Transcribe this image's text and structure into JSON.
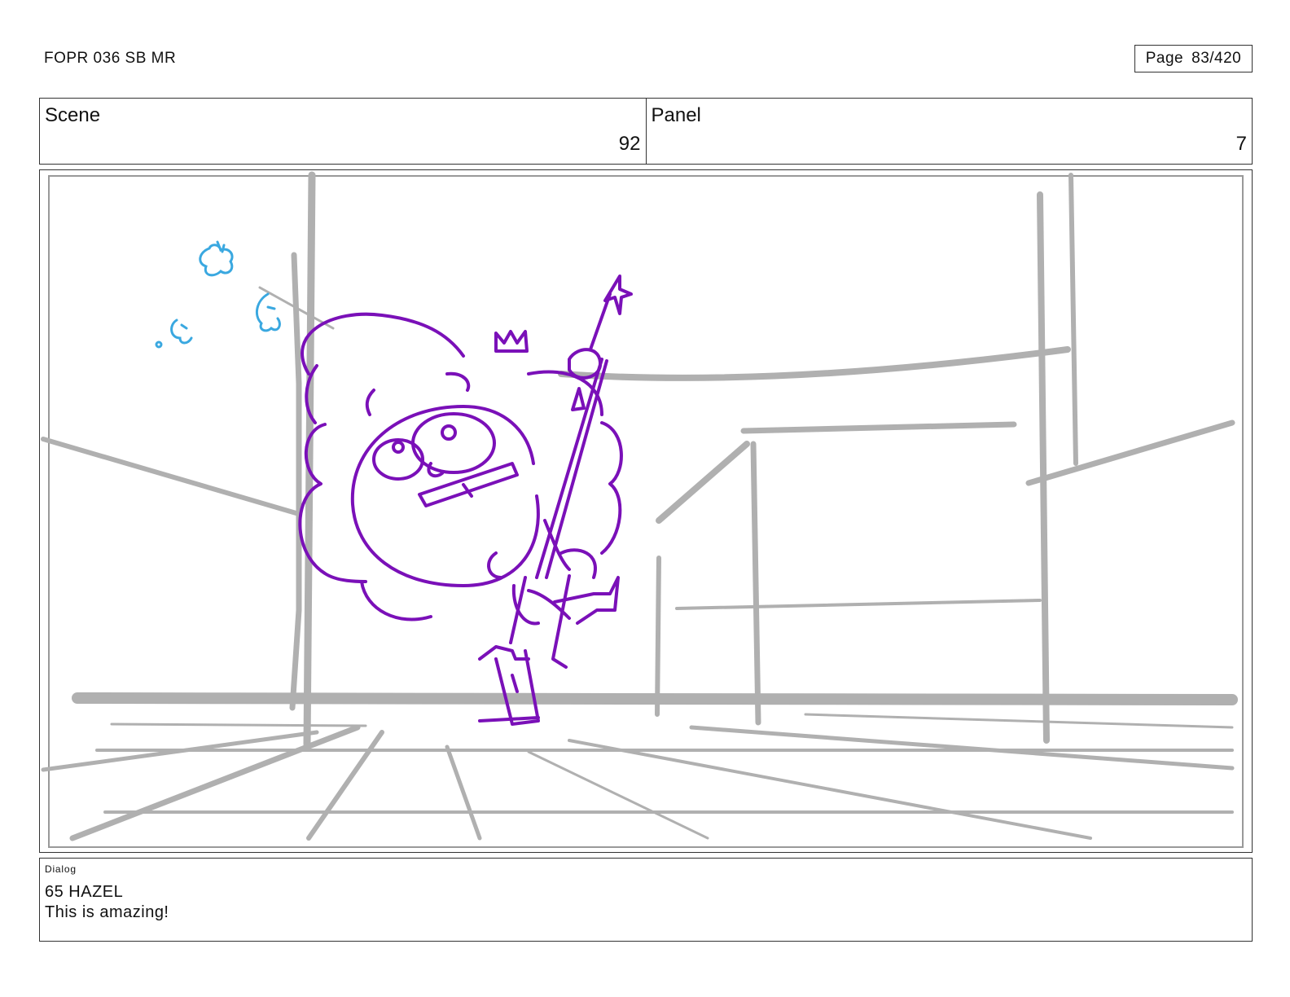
{
  "header": {
    "title": "FOPR 036 SB MR",
    "page_label": "Page",
    "page_number": "83/420"
  },
  "info": {
    "scene_label": "Scene",
    "scene_value": "92",
    "panel_label": "Panel",
    "panel_value": "7"
  },
  "dialog": {
    "label": "Dialog",
    "line1": "65 HAZEL",
    "line2": "This is amazing!"
  },
  "colors": {
    "background_sketch": "#b0b0b0",
    "character_sketch": "#7a10b8",
    "effect_sketch": "#3aa8e0"
  }
}
